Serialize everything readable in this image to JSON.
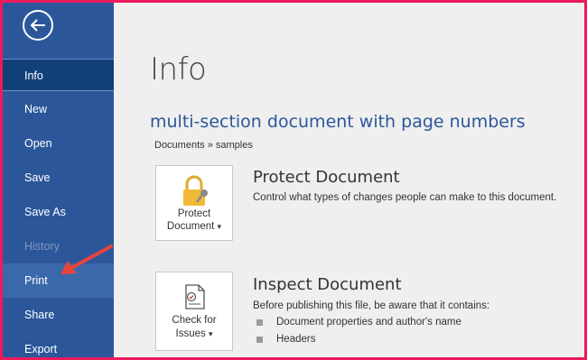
{
  "sidebar": {
    "items": [
      {
        "label": "Info"
      },
      {
        "label": "New"
      },
      {
        "label": "Open"
      },
      {
        "label": "Save"
      },
      {
        "label": "Save As"
      },
      {
        "label": "History"
      },
      {
        "label": "Print"
      },
      {
        "label": "Share"
      },
      {
        "label": "Export"
      }
    ]
  },
  "main": {
    "title": "Info",
    "document_title": "multi-section document with page numbers",
    "breadcrumb": "Documents » samples",
    "protect": {
      "tile_line1": "Protect",
      "tile_line2": "Document",
      "dropdown_glyph": "▾",
      "heading": "Protect Document",
      "description": "Control what types of changes people can make to this document."
    },
    "inspect": {
      "tile_line1": "Check for",
      "tile_line2": "Issues",
      "dropdown_glyph": "▾",
      "heading": "Inspect Document",
      "description": "Before publishing this file, be aware that it contains:",
      "bullets": [
        "Document properties and author's name",
        "Headers"
      ]
    }
  },
  "colors": {
    "sidebar": "#2b579a",
    "accent_border": "#ee1a5c",
    "annotation_arrow": "#e8453c"
  },
  "icons": {
    "back": "back-arrow-icon",
    "protect": "lock-key-icon",
    "inspect": "document-checklist-icon"
  }
}
